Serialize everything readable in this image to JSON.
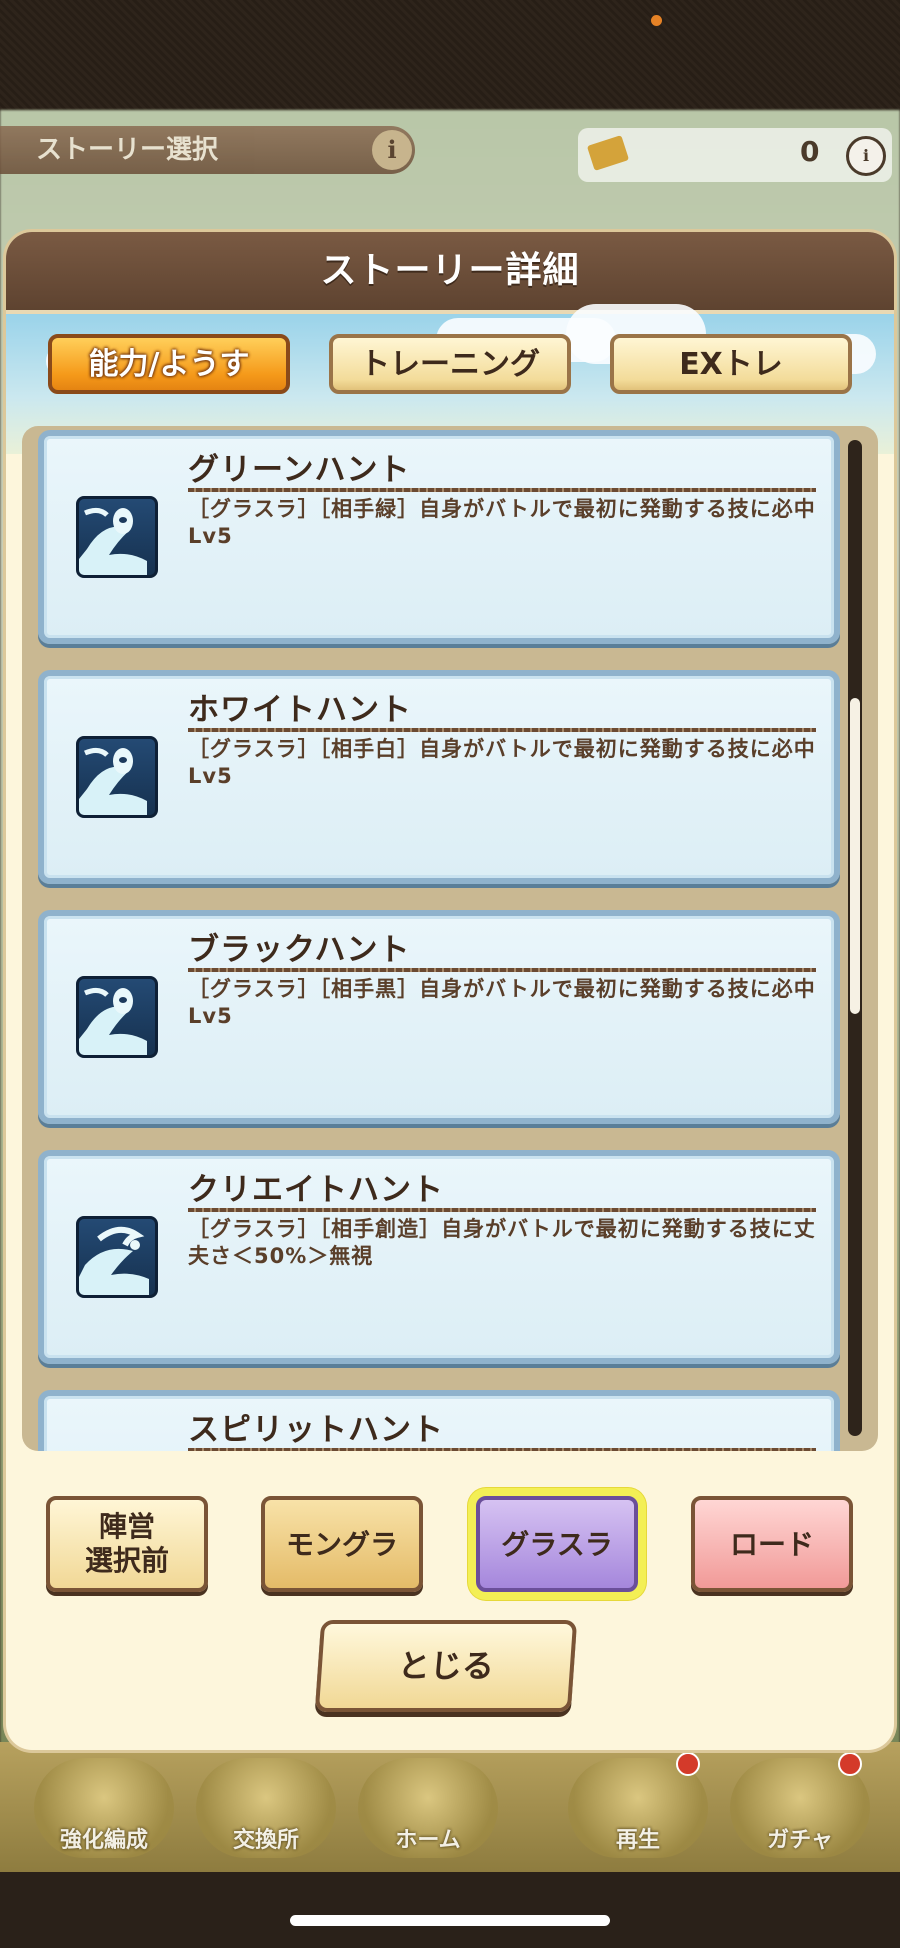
{
  "modal": {
    "title": "ストーリー詳細",
    "tabs": [
      {
        "label": "能力/ようす",
        "active": true
      },
      {
        "label": "トレーニング",
        "active": false
      },
      {
        "label": "EXトレ",
        "active": false
      }
    ],
    "skills": [
      {
        "name": "グリーンハント",
        "description": "［グラスラ］［相手緑］自身がバトルで最初に発動する技に必中Lv5"
      },
      {
        "name": "ホワイトハント",
        "description": "［グラスラ］［相手白］自身がバトルで最初に発動する技に必中Lv5"
      },
      {
        "name": "ブラックハント",
        "description": "［グラスラ］［相手黒］自身がバトルで最初に発動する技に必中Lv5"
      },
      {
        "name": "クリエイトハント",
        "description": "［グラスラ］［相手創造］自身がバトルで最初に発動する技に丈夫さ＜50%＞無視"
      },
      {
        "name": "スピリットハント",
        "description": ""
      }
    ],
    "filters": [
      {
        "label_line1": "陣営",
        "label_line2": "選択前",
        "selected": false
      },
      {
        "label": "モングラ",
        "selected": false
      },
      {
        "label": "グラスラ",
        "selected": true
      },
      {
        "label": "ロード",
        "selected": false
      }
    ],
    "close_label": "とじる"
  },
  "background": {
    "story_select_label": "ストーリー選択",
    "currency_count": "0",
    "nav": [
      "強化編成",
      "交換所",
      "ホーム",
      "再生",
      "ガチャ"
    ]
  },
  "colors": {
    "active_tab": "#f59a1a",
    "card_border": "#8fb2cc",
    "selected_filter": "#a587dc",
    "header": "#6b4e38"
  }
}
